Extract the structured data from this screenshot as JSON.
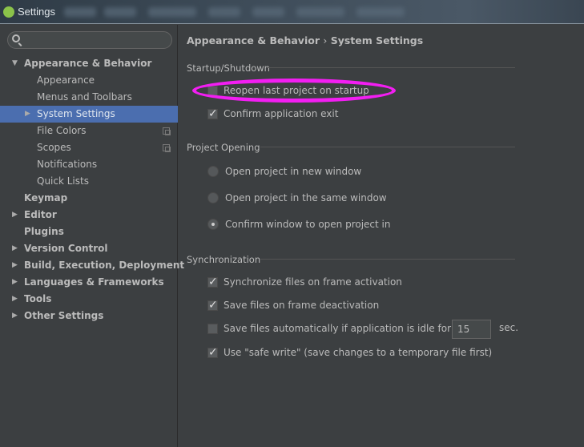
{
  "window": {
    "title": "Settings"
  },
  "search": {
    "placeholder": ""
  },
  "sidebar": {
    "items": [
      {
        "label": "Appearance & Behavior",
        "level": 0,
        "bold": true,
        "arrow": "expanded"
      },
      {
        "label": "Appearance",
        "level": 1
      },
      {
        "label": "Menus and Toolbars",
        "level": 1
      },
      {
        "label": "System Settings",
        "level": 1,
        "selected": true,
        "arrow": "collapsed"
      },
      {
        "label": "File Colors",
        "level": 1,
        "copy_icon": true
      },
      {
        "label": "Scopes",
        "level": 1,
        "copy_icon": true
      },
      {
        "label": "Notifications",
        "level": 1
      },
      {
        "label": "Quick Lists",
        "level": 1
      },
      {
        "label": "Keymap",
        "level": 0,
        "bold": true
      },
      {
        "label": "Editor",
        "level": 0,
        "bold": true,
        "arrow": "collapsed"
      },
      {
        "label": "Plugins",
        "level": 0,
        "bold": true
      },
      {
        "label": "Version Control",
        "level": 0,
        "bold": true,
        "arrow": "collapsed"
      },
      {
        "label": "Build, Execution, Deployment",
        "level": 0,
        "bold": true,
        "arrow": "collapsed"
      },
      {
        "label": "Languages & Frameworks",
        "level": 0,
        "bold": true,
        "arrow": "collapsed"
      },
      {
        "label": "Tools",
        "level": 0,
        "bold": true,
        "arrow": "collapsed"
      },
      {
        "label": "Other Settings",
        "level": 0,
        "bold": true,
        "arrow": "collapsed"
      }
    ]
  },
  "breadcrumb": {
    "parent": "Appearance & Behavior",
    "separator": "›",
    "current": "System Settings"
  },
  "startup": {
    "title": "Startup/Shutdown",
    "reopen": {
      "label": "Reopen last project on startup",
      "checked": false
    },
    "confirm_exit": {
      "label": "Confirm application exit",
      "checked": true
    }
  },
  "project_opening": {
    "title": "Project Opening",
    "options": [
      {
        "label": "Open project in new window",
        "selected": false
      },
      {
        "label": "Open project in the same window",
        "selected": false
      },
      {
        "label": "Confirm window to open project in",
        "selected": true
      }
    ]
  },
  "sync": {
    "title": "Synchronization",
    "sync_files": {
      "label": "Synchronize files on frame activation",
      "checked": true
    },
    "save_deactivation": {
      "label": "Save files on frame deactivation",
      "checked": true
    },
    "save_idle": {
      "label": "Save files automatically if application is idle for",
      "checked": false,
      "value": "15",
      "unit": "sec."
    },
    "safe_write": {
      "label": "Use \"safe write\" (save changes to a temporary file first)",
      "checked": true
    }
  },
  "colors": {
    "highlight_ellipse": "#f21ef2",
    "selection": "#4b6eaf"
  }
}
